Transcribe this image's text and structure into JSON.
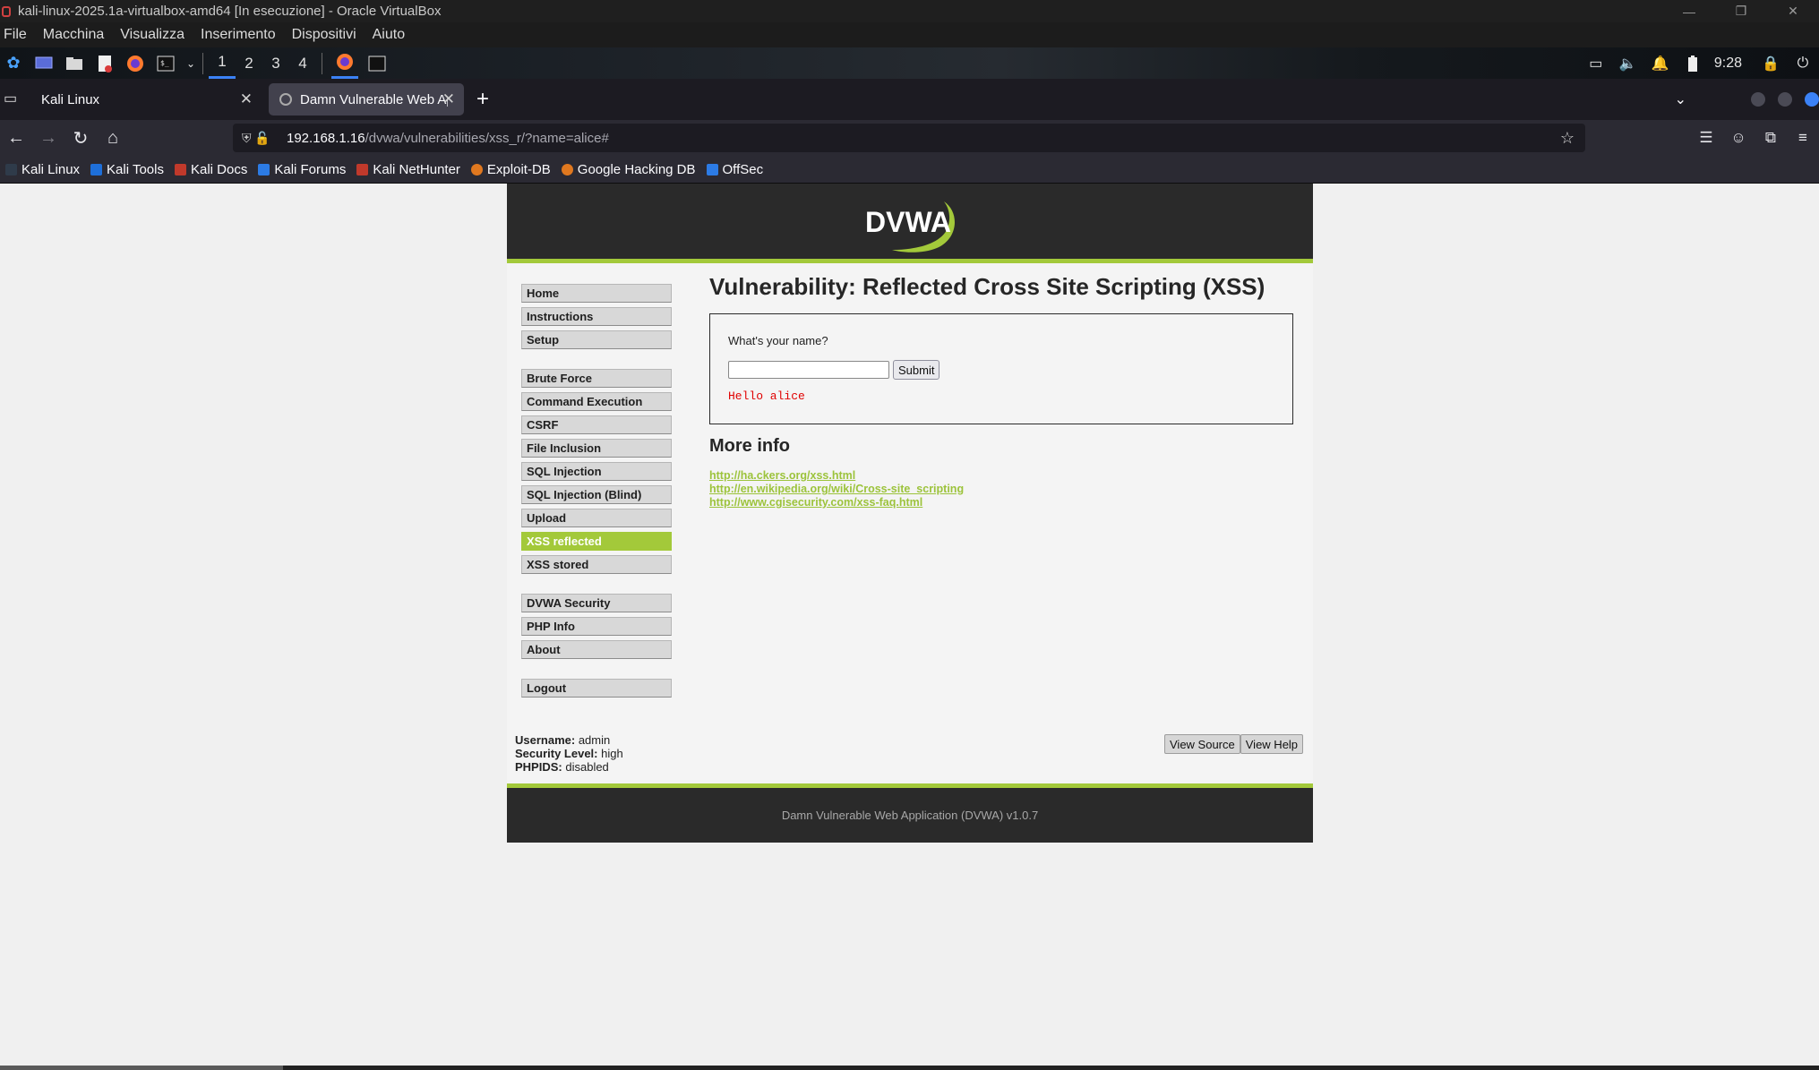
{
  "vbox": {
    "window_title": "kali-linux-2025.1a-virtualbox-amd64 [In esecuzione] - Oracle VirtualBox",
    "menus": [
      "File",
      "Macchina",
      "Visualizza",
      "Inserimento",
      "Dispositivi",
      "Aiuto"
    ]
  },
  "panel": {
    "workspaces": [
      "1",
      "2",
      "3",
      "4"
    ],
    "clock": "9:28"
  },
  "browser": {
    "tabs": [
      {
        "label": "Kali Linux"
      },
      {
        "label": "Damn Vulnerable Web Ap"
      }
    ],
    "new_tab": "+",
    "url_host": "192.168.1.16",
    "url_path": "/dvwa/vulnerabilities/xss_r/?name=alice#",
    "bookmarks": [
      {
        "label": "Kali Linux",
        "color": "#2f3b4a"
      },
      {
        "label": "Kali Tools",
        "color": "#1e6fd9"
      },
      {
        "label": "Kali Docs",
        "color": "#c0392b"
      },
      {
        "label": "Kali Forums",
        "color": "#2c7be5"
      },
      {
        "label": "Kali NetHunter",
        "color": "#c0392b"
      },
      {
        "label": "Exploit-DB",
        "color": "#e0781f"
      },
      {
        "label": "Google Hacking DB",
        "color": "#e0781f"
      },
      {
        "label": "OffSec",
        "color": "#2c7be5"
      }
    ]
  },
  "dvwa": {
    "logo_text": "DVWA",
    "menu": {
      "group1": [
        "Home",
        "Instructions",
        "Setup"
      ],
      "group2": [
        "Brute Force",
        "Command Execution",
        "CSRF",
        "File Inclusion",
        "SQL Injection",
        "SQL Injection (Blind)",
        "Upload",
        "XSS reflected",
        "XSS stored"
      ],
      "group3": [
        "DVWA Security",
        "PHP Info",
        "About"
      ],
      "group4": [
        "Logout"
      ],
      "selected": "XSS reflected"
    },
    "title": "Vulnerability: Reflected Cross Site Scripting (XSS)",
    "form": {
      "question": "What's your name?",
      "input_value": "",
      "submit_label": "Submit",
      "result": "Hello alice"
    },
    "more_info_title": "More info",
    "links": [
      "http://ha.ckers.org/xss.html",
      "http://en.wikipedia.org/wiki/Cross-site_scripting",
      "http://www.cgisecurity.com/xss-faq.html"
    ],
    "user_info": {
      "username_label": "Username:",
      "username": "admin",
      "security_label": "Security Level:",
      "security": "high",
      "phpids_label": "PHPIDS:",
      "phpids": "disabled"
    },
    "view_source_label": "View Source",
    "view_help_label": "View Help",
    "footer": "Damn Vulnerable Web Application (DVWA) v1.0.7",
    "accent_color": "#a3c93a"
  }
}
